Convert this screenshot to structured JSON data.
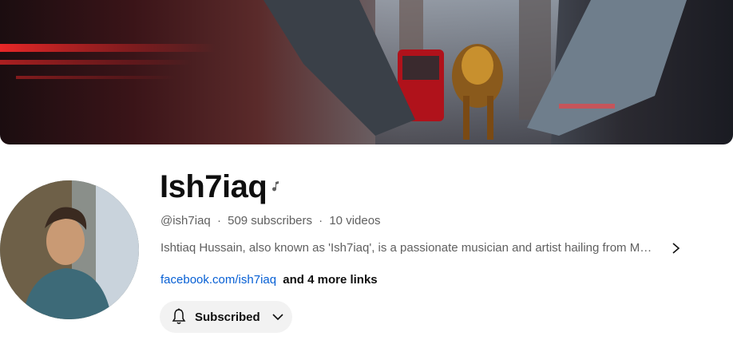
{
  "channel": {
    "title": "Ish7iaq",
    "handle": "@ish7iaq",
    "subscribers": "509 subscribers",
    "videos": "10 videos",
    "separator": "·",
    "description": "Ishtiaq Hussain, also known as 'Ish7iaq', is a passionate musician and artist hailing from M…",
    "link_text": "facebook.com/ish7iaq",
    "more_links": "and 4 more links"
  },
  "subscribe_button": {
    "label": "Subscribed",
    "icon": "bell-icon",
    "dropdown_icon": "chevron-down-icon"
  },
  "icons": {
    "music_badge": "music-note-icon",
    "description_expand": "chevron-right-icon"
  },
  "colors": {
    "link": "#065fd4",
    "secondary_text": "#606060",
    "button_bg": "#f2f2f2"
  }
}
